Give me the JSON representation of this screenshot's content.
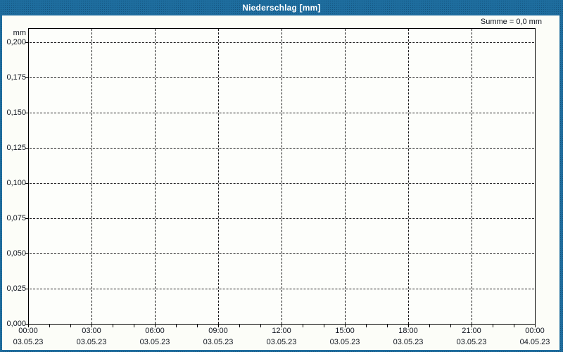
{
  "window": {
    "title": "Niederschlag [mm]"
  },
  "summary_label": "Summe = 0,0 mm",
  "axis_unit_label": "mm",
  "colors": {
    "frame_blue": "#1e6d9e",
    "panel_bg": "#fcfdf8",
    "plot_bg": "#fdfefb",
    "plot_border": "#000000",
    "grid": "#1c1c1c",
    "label_text": "#10151e",
    "title_text": "#ffffff"
  },
  "chart_data": {
    "type": "bar",
    "title": "Niederschlag [mm]",
    "ylabel": "mm",
    "ylim": [
      0,
      0.21
    ],
    "ytick_values": [
      0,
      0.025,
      0.05,
      0.075,
      0.1,
      0.125,
      0.15,
      0.175,
      0.2
    ],
    "ytick_labels": [
      "0,000",
      "0,025",
      "0,050",
      "0,075",
      "0,100",
      "0,125",
      "0,150",
      "0,175",
      "0,200"
    ],
    "xtick_times": [
      "00:00",
      "03:00",
      "06:00",
      "09:00",
      "12:00",
      "15:00",
      "18:00",
      "21:00",
      "00:00"
    ],
    "xtick_dates": [
      "03.05.23",
      "03.05.23",
      "03.05.23",
      "03.05.23",
      "03.05.23",
      "03.05.23",
      "03.05.23",
      "03.05.23",
      "04.05.23"
    ],
    "minor_ticks_per_interval": 3,
    "grid_style": "dashed",
    "legend": null,
    "series": [],
    "sum_annotation": "Summe = 0,0 mm"
  }
}
